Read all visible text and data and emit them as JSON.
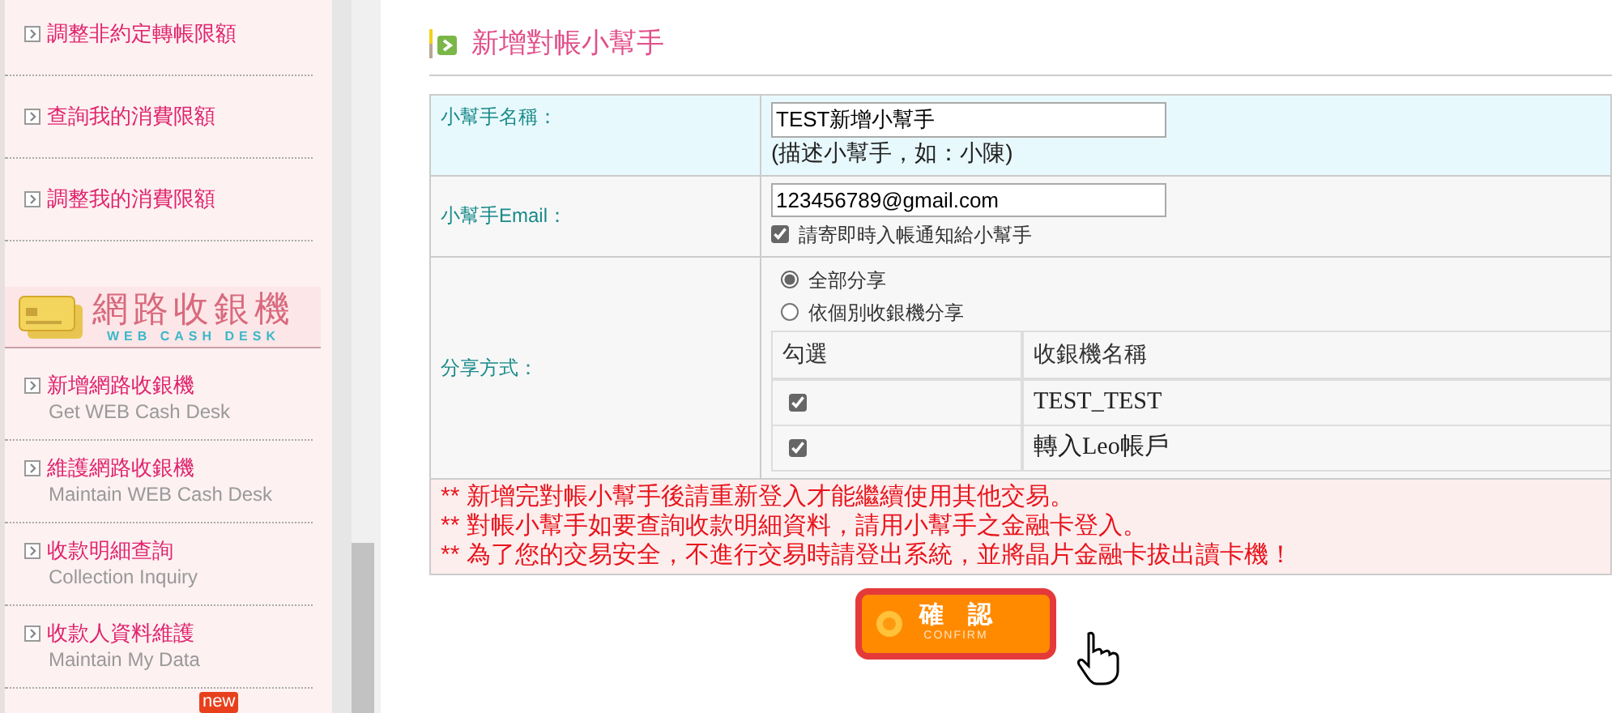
{
  "sidebar": {
    "items": [
      {
        "label": "調整非約定轉帳限額"
      },
      {
        "label": "查詢我的消費限額"
      },
      {
        "label": "調整我的消費限額"
      }
    ],
    "section": {
      "title": "網路收銀機",
      "subtitle": "WEB CASH DESK"
    },
    "section_items": [
      {
        "label": "新增網路收銀機",
        "sublabel": "Get WEB Cash Desk"
      },
      {
        "label": "維護網路收銀機",
        "sublabel": "Maintain WEB Cash Desk"
      },
      {
        "label": "收款明細查詢",
        "sublabel": "Collection Inquiry"
      },
      {
        "label": "收款人資料維護",
        "sublabel": "Maintain My Data"
      }
    ],
    "new_badge": "new"
  },
  "heading": "新增對帳小幫手",
  "form": {
    "name_label": "小幫手名稱：",
    "name_value": "TEST新增小幫手",
    "name_hint": "(描述小幫手，如：小陳)",
    "email_label": "小幫手Email：",
    "email_value": "123456789@gmail.com",
    "notify": {
      "label": "請寄即時入帳通知給小幫手",
      "checked": true
    },
    "share_label": "分享方式：",
    "share_options": [
      {
        "label": "全部分享",
        "selected": true
      },
      {
        "label": "依個別收銀機分享",
        "selected": false
      }
    ],
    "desk_columns": [
      "勾選",
      "收銀機名稱"
    ],
    "desks": [
      {
        "name": "TEST_TEST",
        "checked": true
      },
      {
        "name": "轉入Leo帳戶",
        "checked": true
      }
    ]
  },
  "notes": [
    "** 新增完對帳小幫手後請重新登入才能繼續使用其他交易。",
    "** 對帳小幫手如要查詢收款明細資料，請用小幫手之金融卡登入。",
    "** 為了您的交易安全，不進行交易時請登出系統，並將晶片金融卡拔出讀卡機！"
  ],
  "confirm": {
    "label": "確　認",
    "sublabel": "CONFIRM"
  }
}
